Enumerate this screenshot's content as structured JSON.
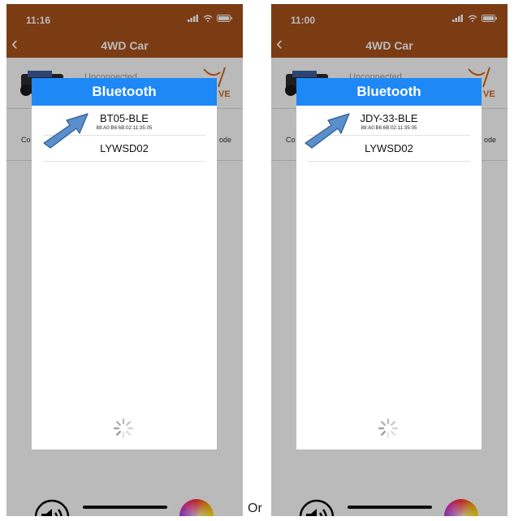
{
  "screens": [
    {
      "time": "11:16",
      "nav_title": "4WD Car",
      "back_glyph": "‹",
      "background_status": "Unconnected",
      "background_left_label": "Co",
      "background_right_label": "ode",
      "logo_text": "VE",
      "dialog": {
        "title": "Bluetooth",
        "devices": [
          {
            "name": "BT05-BLE",
            "address": "88:A0:B6:6B:02:11:35:05"
          },
          {
            "name": "LYWSD02",
            "address": ""
          }
        ]
      }
    },
    {
      "time": "11:00",
      "nav_title": "4WD Car",
      "back_glyph": "‹",
      "background_status": "Unconnected",
      "background_left_label": "Co",
      "background_right_label": "ode",
      "logo_text": "VE",
      "dialog": {
        "title": "Bluetooth",
        "devices": [
          {
            "name": "JDY-33-BLE",
            "address": "88:A0:B6:6B:02:11:35:05"
          },
          {
            "name": "LYWSD02",
            "address": ""
          }
        ]
      }
    }
  ],
  "separator_text": "Or",
  "colors": {
    "nav": "#a9531c",
    "dialog_header": "#1e88f7",
    "arrow": "#5b8fcb"
  },
  "icons": [
    "signal-icon",
    "wifi-icon",
    "battery-icon",
    "back-icon",
    "speaker-icon",
    "color-wheel-icon",
    "loading-spinner-icon",
    "pointer-arrow-icon",
    "car-image",
    "brand-logo"
  ]
}
